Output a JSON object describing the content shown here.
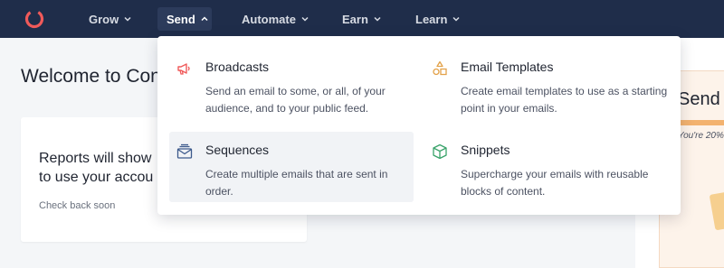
{
  "nav": {
    "items": [
      {
        "label": "Grow",
        "icon": "chevron-down-icon"
      },
      {
        "label": "Send",
        "icon": "chevron-up-icon",
        "active": true
      },
      {
        "label": "Automate",
        "icon": "chevron-down-icon"
      },
      {
        "label": "Earn",
        "icon": "chevron-down-icon"
      },
      {
        "label": "Learn",
        "icon": "chevron-down-icon"
      }
    ],
    "brand_color": "#f05a5a",
    "bg_color": "#1f2d4a"
  },
  "page": {
    "title": "Welcome to Con",
    "report_text": "Reports will show\nto use your accou",
    "report_sub": "Check back soon"
  },
  "promo": {
    "title": "Send",
    "subtitle": "You're 20%"
  },
  "dropdown": {
    "items": [
      {
        "title": "Broadcasts",
        "description": "Send an email to some, or all, of your audience, and to your public feed.",
        "icon": "megaphone-icon"
      },
      {
        "title": "Email Templates",
        "description": "Create email templates to use as a starting point in your emails.",
        "icon": "shapes-icon"
      },
      {
        "title": "Sequences",
        "description": "Create multiple emails that are sent in order.",
        "icon": "email-stack-icon",
        "hovered": true
      },
      {
        "title": "Snippets",
        "description": "Supercharge your emails with reusable blocks of content.",
        "icon": "cube-icon"
      }
    ]
  }
}
